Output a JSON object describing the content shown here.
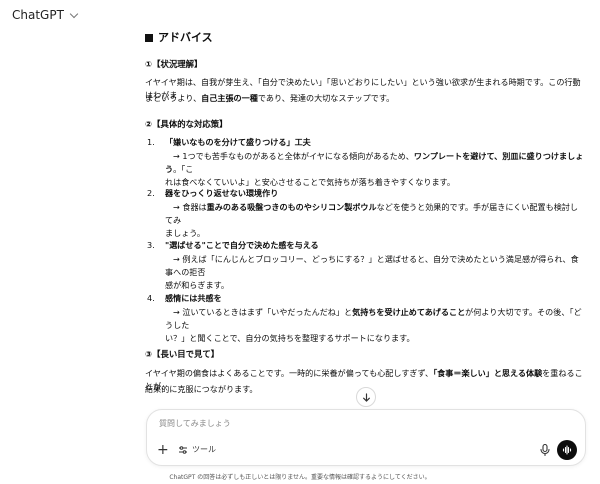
{
  "app": {
    "title": "ChatGPT"
  },
  "content": {
    "heading": "アドバイス",
    "section1": {
      "title": "①【状況理解】",
      "p_a": "イヤイヤ期は、自我が芽生え、「自分で決めたい」「思いどおりにしたい」という強い欲求が生まれる時期です。この行動はわがま",
      "p_b1": "まというより、",
      "p_b2": "自己主張の一種",
      "p_b3": "であり、発達の大切なステップです。"
    },
    "section2": {
      "title": "②【具体的な対応策】",
      "items": [
        {
          "num": "1.",
          "title": "「嫌いなものを分けて盛りつける」工夫",
          "l1a": "→ 1つでも苦手なものがあると全体がイヤになる傾向があるため、",
          "l1b": "ワンプレートを避けて、別皿に盛りつけましょう",
          "l1c": "。「こ",
          "l2": "れは食べなくていいよ」と安心させることで気持ちが落ち着きやすくなります。"
        },
        {
          "num": "2.",
          "title": "器をひっくり返せない環境作り",
          "l1a": "→ 食器は",
          "l1b": "重みのある吸盤つきのものやシリコン製ボウル",
          "l1c": "などを使うと効果的です。手が届きにくい配置も検討してみ",
          "l2": "ましょう。"
        },
        {
          "num": "3.",
          "title": "\"選ばせる\"ことで自分で決めた感を与える",
          "l1a": "→ 例えば「にんじんとブロッコリー、どっちにする？」と選ばせると、自分で決めたという満足感が得られ、食事への拒否",
          "l1b": "",
          "l1c": "",
          "l2": "感が和らぎます。"
        },
        {
          "num": "4.",
          "title": "感情には共感を",
          "l1a": "→ 泣いているときはまず「いやだったんだね」と",
          "l1b": "気持ちを受け止めてあげること",
          "l1c": "が何より大切です。その後、「どうした",
          "l2": "い？」と聞くことで、自分の気持ちを整理するサポートになります。"
        }
      ]
    },
    "section3": {
      "title": "③【長い目で見て】",
      "p_a1": "イヤイヤ期の偏食はよくあることです。一時的に栄養が偏っても心配しすぎず、",
      "p_a2": "「食事＝楽しい」と思える体験",
      "p_a3": "を重ねることが、",
      "p_b": "結果的に克服につながります。"
    }
  },
  "composer": {
    "placeholder": "質問してみましょう",
    "tools_label": "ツール"
  },
  "footer": {
    "disclaimer": "ChatGPT の回答は必ずしも正しいとは限りません。重要な情報は確認するようにしてください。"
  }
}
